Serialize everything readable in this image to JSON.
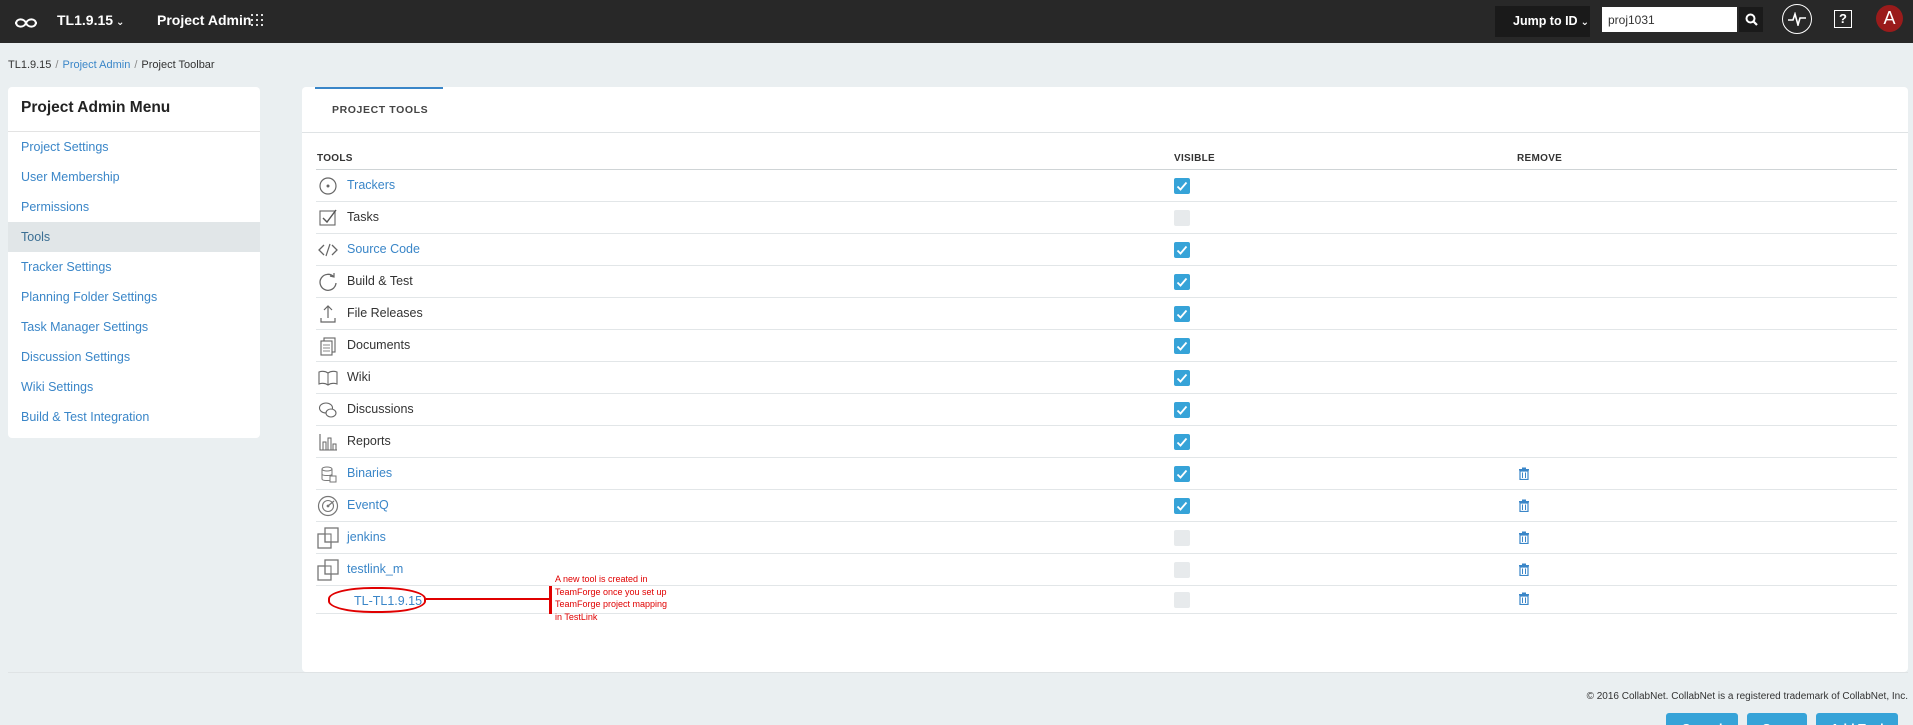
{
  "topbar": {
    "project_name": "TL1.9.15",
    "section_title": "Project Admin",
    "jump_label": "Jump to ID",
    "search_value": "proj1031",
    "help_label": "?",
    "avatar_letter": "A"
  },
  "breadcrumb": {
    "items": [
      "TL1.9.15",
      "Project Admin",
      "Project Toolbar"
    ]
  },
  "sidebar": {
    "title": "Project Admin Menu",
    "items": [
      {
        "label": "Project Settings",
        "active": false
      },
      {
        "label": "User Membership",
        "active": false
      },
      {
        "label": "Permissions",
        "active": false
      },
      {
        "label": "Tools",
        "active": true
      },
      {
        "label": "Tracker Settings",
        "active": false
      },
      {
        "label": "Planning Folder Settings",
        "active": false
      },
      {
        "label": "Task Manager Settings",
        "active": false
      },
      {
        "label": "Discussion Settings",
        "active": false
      },
      {
        "label": "Wiki Settings",
        "active": false
      },
      {
        "label": "Build & Test Integration",
        "active": false
      }
    ]
  },
  "tab": {
    "label": "PROJECT TOOLS"
  },
  "table": {
    "headers": [
      "TOOLS",
      "VISIBLE",
      "REMOVE"
    ],
    "rows": [
      {
        "name": "Trackers",
        "icon": "trackers-icon",
        "link": true,
        "visible": true,
        "removable": false
      },
      {
        "name": "Tasks",
        "icon": "tasks-icon",
        "link": false,
        "visible": false,
        "removable": false
      },
      {
        "name": "Source Code",
        "icon": "source-code-icon",
        "link": true,
        "visible": true,
        "removable": false
      },
      {
        "name": "Build & Test",
        "icon": "build-test-icon",
        "link": false,
        "visible": true,
        "removable": false
      },
      {
        "name": "File Releases",
        "icon": "file-releases-icon",
        "link": false,
        "visible": true,
        "removable": false
      },
      {
        "name": "Documents",
        "icon": "documents-icon",
        "link": false,
        "visible": true,
        "removable": false
      },
      {
        "name": "Wiki",
        "icon": "wiki-icon",
        "link": false,
        "visible": true,
        "removable": false
      },
      {
        "name": "Discussions",
        "icon": "discussions-icon",
        "link": false,
        "visible": true,
        "removable": false
      },
      {
        "name": "Reports",
        "icon": "reports-icon",
        "link": false,
        "visible": true,
        "removable": false
      },
      {
        "name": "Binaries",
        "icon": "binaries-icon",
        "link": true,
        "visible": true,
        "removable": true
      },
      {
        "name": "EventQ",
        "icon": "eventq-icon",
        "link": true,
        "visible": true,
        "removable": true
      },
      {
        "name": "jenkins",
        "icon": "external-tool-icon",
        "link": true,
        "visible": false,
        "removable": true
      },
      {
        "name": "testlink_m",
        "icon": "external-tool-icon",
        "link": true,
        "visible": false,
        "removable": true
      },
      {
        "name": "TL-TL1.9.15",
        "icon": "none",
        "link": true,
        "visible": false,
        "removable": true
      }
    ]
  },
  "annotation": {
    "text": "A new tool is created in TeamForge once you set up TeamForge project mapping in TestLink",
    "color": "#e00000"
  },
  "buttons": {
    "cancel": "Cancel",
    "save": "Save",
    "add_tool": "Add Tool"
  },
  "footer": {
    "text": "© 2016 CollabNet. CollabNet is a registered trademark of CollabNet, Inc."
  },
  "colors": {
    "accent": "#36a3d8",
    "link": "#3a86c8",
    "topbar": "#282828",
    "avatar": "#9a1b1b"
  }
}
